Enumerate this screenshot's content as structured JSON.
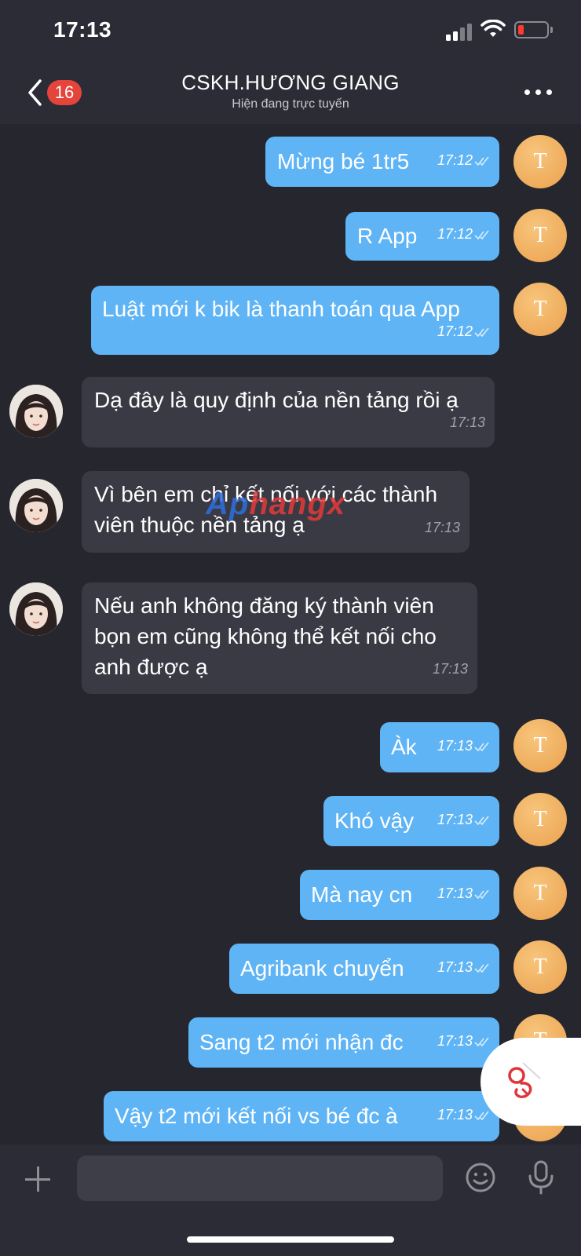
{
  "status_bar": {
    "time": "17:13"
  },
  "header": {
    "unread_count": "16",
    "title": "CSKH.HƯƠNG GIANG",
    "subtitle": "Hiện đang trực tuyến"
  },
  "messages": [
    {
      "direction": "out",
      "text": "Mừng bé 1tr5",
      "time": "17:12",
      "avatar": "T"
    },
    {
      "direction": "out",
      "text": "R App",
      "time": "17:12",
      "avatar": "T"
    },
    {
      "direction": "out",
      "text": "Luật mới k bik là thanh toán qua App",
      "time": "17:12",
      "avatar": "T"
    },
    {
      "direction": "in",
      "text": "Dạ đây là quy định của nền tảng rồi ạ",
      "time": "17:13"
    },
    {
      "direction": "in",
      "text": "Vì bên em chỉ kết nối với các thành viên thuộc nền tảng ạ",
      "time": "17:13"
    },
    {
      "direction": "in",
      "text": "Nếu anh không đăng ký thành viên bọn em cũng không thể kết nối cho anh được ạ",
      "time": "17:13"
    },
    {
      "direction": "out",
      "text": "Àk",
      "time": "17:13",
      "avatar": "T"
    },
    {
      "direction": "out",
      "text": "Khó vậy",
      "time": "17:13",
      "avatar": "T"
    },
    {
      "direction": "out",
      "text": "Mà nay cn",
      "time": "17:13",
      "avatar": "T"
    },
    {
      "direction": "out",
      "text": "Agribank chuyển",
      "time": "17:13",
      "avatar": "T"
    },
    {
      "direction": "out",
      "text": "Sang t2 mới nhận đc",
      "time": "17:13",
      "avatar": "T"
    },
    {
      "direction": "out",
      "text": "Vậy t2 mới kết nối vs bé đc à",
      "time": "17:13",
      "avatar": "T"
    }
  ],
  "watermark": {
    "part1": "Ap",
    "part2": "hangx"
  },
  "composer": {
    "placeholder": ""
  },
  "colors": {
    "outgoing_bubble": "#5fb4f5",
    "incoming_bubble": "#3a3a45",
    "badge": "#e5443a",
    "avatar": "#eba14e"
  },
  "icons": [
    "back-icon",
    "more-icon",
    "check-icon",
    "plus-icon",
    "emoji-icon",
    "microphone-icon",
    "float-app-icon"
  ]
}
